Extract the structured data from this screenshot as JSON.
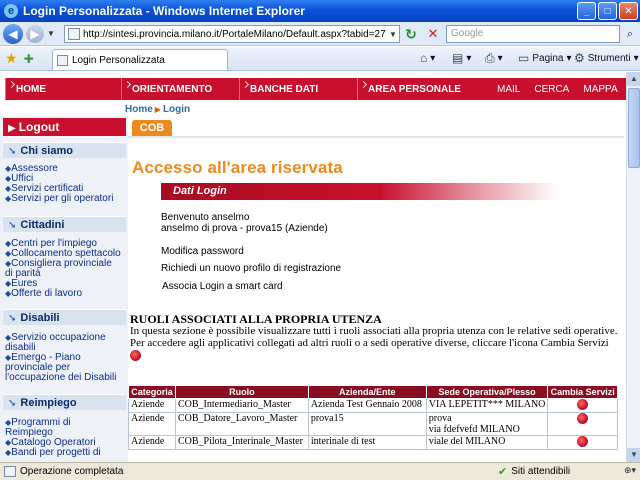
{
  "browser": {
    "title": "Login Personalizzata - Windows Internet Explorer",
    "url": "http://sintesi.provincia.milano.it/PortaleMilano/Default.aspx?tabid=27",
    "search_placeholder": "Google",
    "tab_label": "Login Personalizzata",
    "cmd_page": "Pagina",
    "cmd_tools": "Strumenti",
    "status_text": "Operazione completata",
    "zone_text": "Siti attendibili"
  },
  "topnav": {
    "items": [
      "HOME",
      "ORIENTAMENTO",
      "BANCHE DATI",
      "AREA PERSONALE"
    ],
    "links": [
      "MAIL",
      "CERCA",
      "MAPPA"
    ]
  },
  "breadcrumb": [
    "Home",
    "Login"
  ],
  "badge": "COB",
  "sidebar": {
    "logout": "Logout",
    "sections": [
      {
        "title": "Chi siamo",
        "links": [
          "Assessore",
          "Uffici",
          "Servizi certificati",
          "Servizi per gli operatori"
        ]
      },
      {
        "title": "Cittadini",
        "links": [
          "Centri per l'impiego",
          "Collocamento spettacolo",
          "Consigliera provinciale",
          "di parità",
          "Eures",
          "Offerte di lavoro"
        ]
      },
      {
        "title": "Disabili",
        "links": [
          "Servizio occupazione",
          "disabili",
          "Emergo - Piano",
          "provinciale per",
          "l'occupazione dei Disabili"
        ]
      },
      {
        "title": "Reimpiego",
        "links": [
          "Programmi di",
          "Reimpiego",
          "Catalogo Operatori",
          "Bandi per progetti di"
        ]
      }
    ]
  },
  "main": {
    "title": "Accesso all'area riservata",
    "dati_login": "Dati Login",
    "welcome_line1": "Benvenuto anselmo",
    "welcome_line2": "anselmo di prova - prova15 (Aziende)",
    "menu": [
      "Modifica password",
      "Richiedi un nuovo profilo di registrazione",
      "Associa Login a smart card"
    ],
    "roles_title": "RUOLI ASSOCIATI ALLA PROPRIA UTENZA",
    "roles_text1": "In questa sezione è possibile visualizzare tutti i ruoli associati alla propria utenza con le relative sedi operative.",
    "roles_text2": "Per accedere agli applicativi collegati ad altri ruoli o a sedi operative diverse, cliccare l'icona Cambia Servizi"
  },
  "table": {
    "headers": [
      "Categoria",
      "Ruolo",
      "Azienda/Ente",
      "Sede Operativa/Plesso",
      "Cambia Servizi"
    ],
    "rows": [
      {
        "categoria": "Aziende",
        "ruolo": "COB_Intermediario_Master",
        "azienda": "Azienda Test Gennaio 2008",
        "sede1": "VIA LEPETIT*** MILANO",
        "sede2": ""
      },
      {
        "categoria": "Aziende",
        "ruolo": "COB_Datore_Lavoro_Master",
        "azienda": "prova15",
        "sede1": "prova",
        "sede2": "via fdefvefd MILANO"
      },
      {
        "categoria": "Aziende",
        "ruolo": "COB_Pilota_Interinale_Master",
        "azienda": "interinale di test",
        "sede1": "viale del MILANO",
        "sede2": ""
      }
    ]
  },
  "colors": {
    "brand_red": "#c8102e",
    "accent_orange": "#ec8a1d",
    "nav_blue": "#0b2d8f"
  }
}
